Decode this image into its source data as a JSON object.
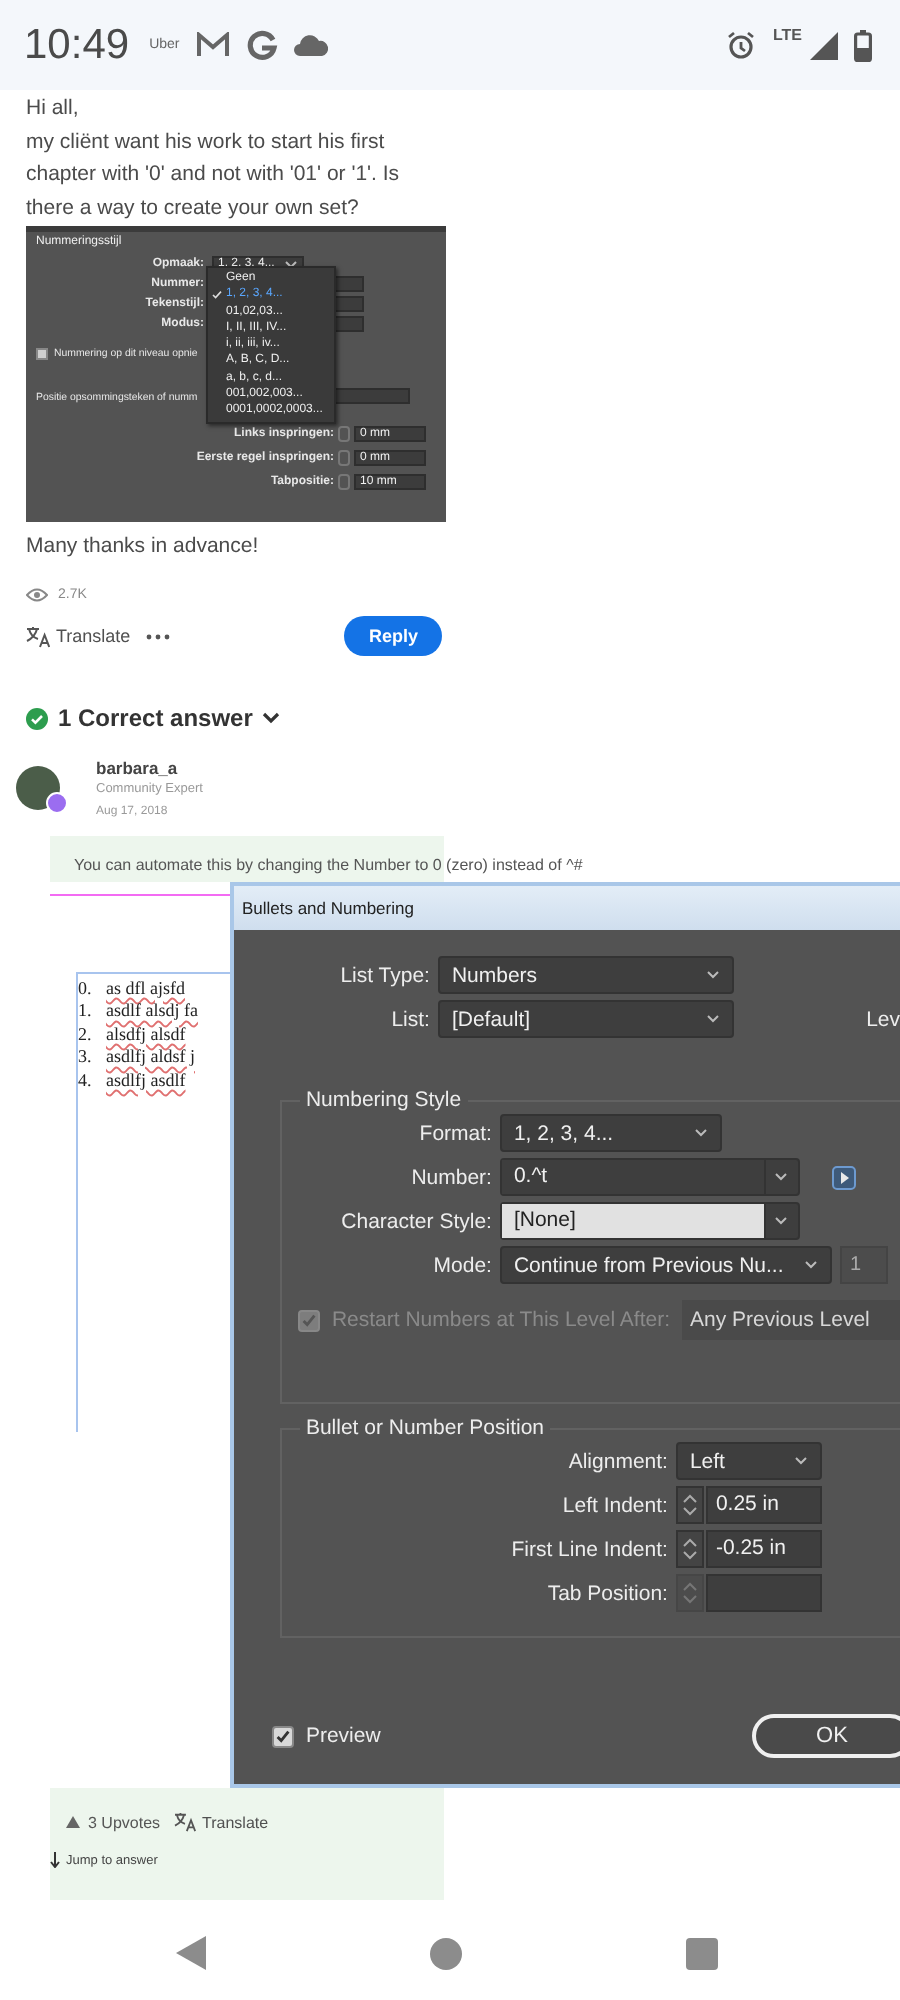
{
  "status_bar": {
    "time": "10:49",
    "notifications": [
      {
        "kind": "text",
        "label": "Uber"
      },
      {
        "kind": "mail"
      },
      {
        "kind": "g-logo"
      },
      {
        "kind": "cloud"
      }
    ],
    "network": "LTE"
  },
  "question": {
    "paragraphs": [
      "Hi all,",
      "my cliënt want his work to start his first chapter with '0' and not with '01' or '1'. Is there a way to create your own set?"
    ],
    "screenshot": {
      "title": "Nummeringsstijl",
      "fields": [
        {
          "label": "Opmaak:",
          "value": "1, 2, 3, 4..."
        },
        {
          "label": "Nummer:"
        },
        {
          "label": "Tekenstijl:"
        },
        {
          "label": "Modus:"
        }
      ],
      "checkbox": {
        "label": "Nummering op dit niveau opnie",
        "checked": true
      },
      "section": "Positie opsommingsteken of numm",
      "indents": [
        {
          "label": "Links inspringen:",
          "value": "0 mm"
        },
        {
          "label": "Eerste regel inspringen:",
          "value": "0 mm"
        },
        {
          "label": "Tabpositie:",
          "value": "10 mm"
        }
      ],
      "menu": [
        {
          "label": "Geen",
          "selected": false
        },
        {
          "label": "1, 2, 3, 4...",
          "selected": true
        },
        {
          "label": "01,02,03...",
          "selected": false
        },
        {
          "label": "I, II, III, IV...",
          "selected": false
        },
        {
          "label": "i, ii, iii, iv...",
          "selected": false
        },
        {
          "label": "A, B, C, D...",
          "selected": false
        },
        {
          "label": "a, b, c, d...",
          "selected": false
        },
        {
          "label": "001,002,003...",
          "selected": false
        },
        {
          "label": "0001,0002,0003...",
          "selected": false
        }
      ]
    },
    "closing": "Many thanks in advance!",
    "views": "2.7K",
    "translate": "Translate",
    "reply": "Reply"
  },
  "correct_answer": {
    "label": "1 Correct answer"
  },
  "answer": {
    "author": "barbara_a",
    "role": "Community Expert",
    "date": "Aug 17, 2018",
    "text": "You can automate this by changing the Number to 0 (zero) instead of ^#",
    "screenshot": {
      "document_list": [
        {
          "number": "0.",
          "text": "as dfl ajsfd"
        },
        {
          "number": "1.",
          "text": "asdlf alsdj fa"
        },
        {
          "number": "2.",
          "text": "alsdfj alsdf"
        },
        {
          "number": "3.",
          "text": "asdlfj aldsf j"
        },
        {
          "number": "4.",
          "text": "asdlfj asdlf"
        }
      ],
      "dialog": {
        "title": "Bullets and Numbering",
        "list_type": {
          "label": "List Type:",
          "value": "Numbers"
        },
        "list": {
          "label": "List:",
          "value": "[Default]"
        },
        "level_label": "Lev",
        "numbering_style": {
          "title": "Numbering Style",
          "format": {
            "label": "Format:",
            "value": "1, 2, 3, 4..."
          },
          "number": {
            "label": "Number:",
            "value": "0.^t"
          },
          "character_style": {
            "label": "Character Style:",
            "value": "[None]"
          },
          "mode": {
            "label": "Mode:",
            "value": "Continue from Previous Nu...",
            "start": "1"
          },
          "restart": {
            "label": "Restart Numbers at This Level After:",
            "value": "Any Previous Level",
            "checked": true,
            "disabled": true
          }
        },
        "position": {
          "title": "Bullet or Number Position",
          "alignment": {
            "label": "Alignment:",
            "value": "Left"
          },
          "indents": [
            {
              "label": "Left Indent:",
              "value": "0.25 in",
              "disabled": false
            },
            {
              "label": "First Line Indent:",
              "value": "-0.25 in",
              "disabled": false
            },
            {
              "label": "Tab Position:",
              "disabled": true
            }
          ]
        },
        "preview": {
          "label": "Preview",
          "checked": true
        },
        "ok": "OK"
      }
    },
    "upvotes": "3 Upvotes",
    "translate": "Translate",
    "jump": "Jump to answer"
  }
}
